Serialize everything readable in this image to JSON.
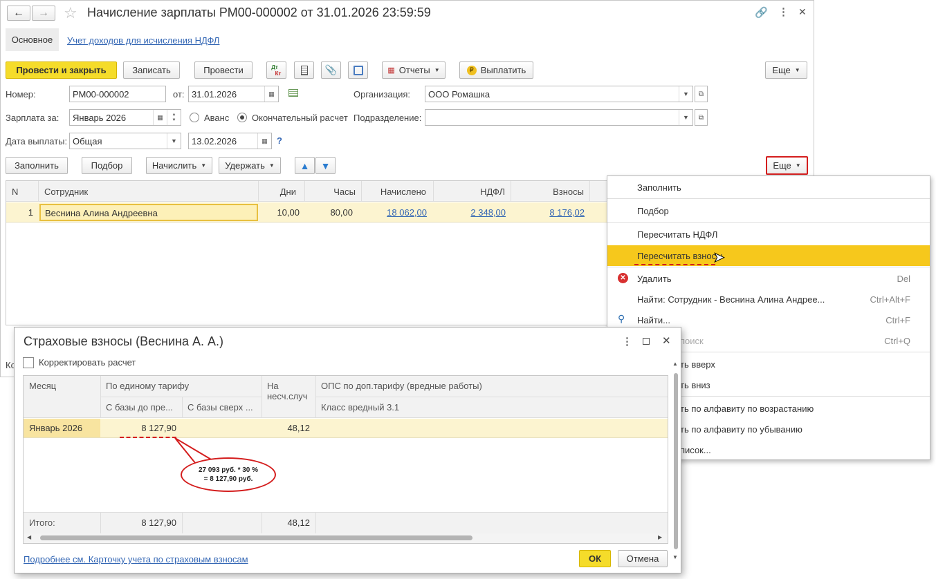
{
  "window": {
    "title": "Начисление зарплаты РМ00-000002 от 31.01.2026 23:59:59",
    "tab_main": "Основное",
    "tab_link": "Учет доходов для исчисления НДФЛ"
  },
  "toolbar": {
    "post_close": "Провести и закрыть",
    "save": "Записать",
    "post": "Провести",
    "dtkt_top": "Дт",
    "dtkt_bottom": "Кт",
    "reports": "Отчеты",
    "pay": "Выплатить",
    "more": "Еще"
  },
  "form": {
    "number_label": "Номер:",
    "number_value": "РМ00-000002",
    "from_label": "от:",
    "date_value": "31.01.2026",
    "org_label": "Организация:",
    "org_value": "ООО Ромашка",
    "salary_for_label": "Зарплата за:",
    "salary_for_value": "Январь 2026",
    "advance_label": "Аванс",
    "final_label": "Окончательный расчет",
    "dept_label": "Подразделение:",
    "dept_value": "",
    "paydate_label": "Дата выплаты:",
    "paydate_type": "Общая",
    "paydate_value": "13.02.2026",
    "help": "?"
  },
  "table_toolbar": {
    "fill": "Заполнить",
    "select": "Подбор",
    "accrue": "Начислить",
    "withhold": "Удержать",
    "more": "Еще"
  },
  "table": {
    "columns": [
      "N",
      "Сотрудник",
      "Дни",
      "Часы",
      "Начислено",
      "НДФЛ",
      "Взносы"
    ],
    "rows": [
      {
        "n": "1",
        "employee": "Веснина Алина Андреевна",
        "days": "10,00",
        "hours": "80,00",
        "accrued": "18 062,00",
        "ndfl": "2 348,00",
        "contrib": "8 176,02"
      }
    ],
    "footer_partial": "Ко"
  },
  "menu": {
    "items": [
      {
        "label": "Заполнить",
        "shortcut": ""
      },
      {
        "label": "Подбор",
        "shortcut": ""
      },
      {
        "label": "Пересчитать НДФЛ",
        "shortcut": ""
      },
      {
        "label": "Пересчитать взносы",
        "shortcut": ""
      },
      {
        "label": "Удалить",
        "shortcut": "Del"
      },
      {
        "label": "Найти: Сотрудник - Веснина Алина Андрее...",
        "shortcut": "Ctrl+Alt+F"
      },
      {
        "label": "Найти...",
        "shortcut": "Ctrl+F"
      },
      {
        "label": "поиск",
        "shortcut": "Ctrl+Q"
      },
      {
        "label": "ть вверх",
        "shortcut": ""
      },
      {
        "label": "ть вниз",
        "shortcut": ""
      },
      {
        "label": "ть по алфавиту по возрастанию",
        "shortcut": ""
      },
      {
        "label": "ть по алфавиту по убыванию",
        "shortcut": ""
      },
      {
        "label": "писок...",
        "shortcut": ""
      }
    ]
  },
  "dialog": {
    "title": "Страховые взносы (Веснина А. А.)",
    "correct_label": "Корректировать расчет",
    "h_month": "Месяц",
    "h_single": "По единому тарифу",
    "h_base_to": "С базы до пре...",
    "h_base_over": "С базы сверх ...",
    "h_accident_1": "На",
    "h_accident_2": "несч.случ",
    "h_ops": "ОПС по доп.тарифу (вредные работы)",
    "h_class": "Класс вредный 3.1",
    "row_month": "Январь 2026",
    "row_base_to": "8 127,90",
    "row_accident": "48,12",
    "total_label": "Итого:",
    "total_base_to": "8 127,90",
    "total_accident": "48,12",
    "callout_1": "27 093 руб. * 30 %",
    "callout_2": "= 8 127,90 руб.",
    "details_link": "Подробнее см. Карточку учета по страховым взносам",
    "ok": "ОК",
    "cancel": "Отмена"
  },
  "colors": {
    "primary_button": "#f5dc2a",
    "selected_row": "#fcf4d0",
    "menu_highlight": "#f6c81c",
    "annotation": "#d41e1e",
    "link": "#3366b4"
  }
}
